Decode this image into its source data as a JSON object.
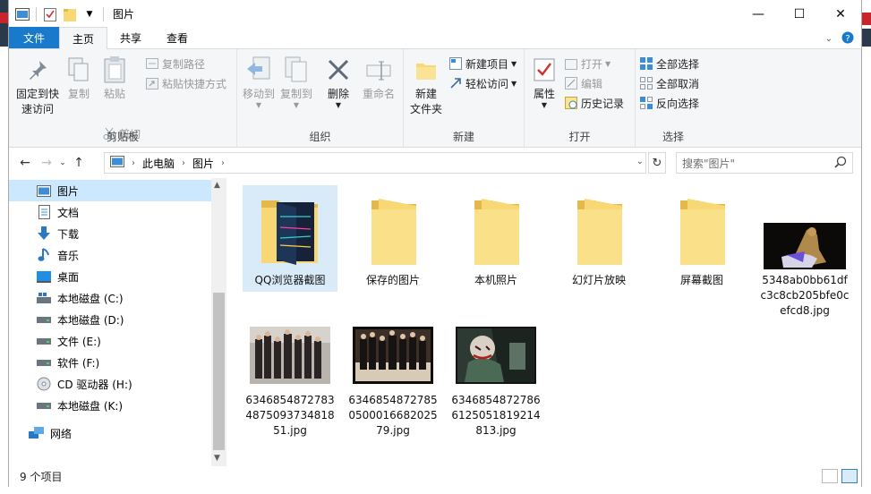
{
  "window": {
    "title": "图片",
    "controls": {
      "minimize": "—",
      "maximize": "☐",
      "close": "✕"
    }
  },
  "tabs": [
    {
      "label": "文件"
    },
    {
      "label": "主页"
    },
    {
      "label": "共享"
    },
    {
      "label": "查看"
    }
  ],
  "ribbon": {
    "clipboard": {
      "group_label": "剪贴板",
      "pin_label_1": "固定到快",
      "pin_label_2": "速访问",
      "copy_label": "复制",
      "paste_label": "粘贴",
      "copy_path_label": "复制路径",
      "paste_shortcut_label": "粘贴快捷方式",
      "cut_label": "剪切"
    },
    "organize": {
      "group_label": "组织",
      "move_to_label": "移动到",
      "copy_to_label": "复制到",
      "delete_label": "删除",
      "rename_label": "重命名"
    },
    "new": {
      "group_label": "新建",
      "new_folder_label_1": "新建",
      "new_folder_label_2": "文件夹",
      "new_item_label": "新建项目",
      "easy_access_label": "轻松访问"
    },
    "open": {
      "group_label": "打开",
      "properties_label": "属性",
      "open_label": "打开",
      "edit_label": "编辑",
      "history_label": "历史记录"
    },
    "select": {
      "group_label": "选择",
      "select_all_label": "全部选择",
      "select_none_label": "全部取消",
      "invert_label": "反向选择"
    }
  },
  "address": {
    "crumbs": [
      "此电脑",
      "图片"
    ],
    "search_placeholder": "搜索\"图片\""
  },
  "nav": {
    "items": [
      {
        "label": "图片",
        "icon": "pictures-icon"
      },
      {
        "label": "文档",
        "icon": "documents-icon"
      },
      {
        "label": "下载",
        "icon": "downloads-icon"
      },
      {
        "label": "音乐",
        "icon": "music-icon"
      },
      {
        "label": "桌面",
        "icon": "desktop-icon"
      },
      {
        "label": "本地磁盘 (C:)",
        "icon": "drive-icon"
      },
      {
        "label": "本地磁盘 (D:)",
        "icon": "drive-icon"
      },
      {
        "label": "文件 (E:)",
        "icon": "drive-icon"
      },
      {
        "label": "软件 (F:)",
        "icon": "drive-icon"
      },
      {
        "label": "CD 驱动器 (H:)",
        "icon": "cd-drive-icon"
      },
      {
        "label": "本地磁盘 (K:)",
        "icon": "drive-icon"
      },
      {
        "label": "网络",
        "icon": "network-icon"
      }
    ]
  },
  "files": [
    {
      "name": "QQ浏览器截图",
      "type": "folder"
    },
    {
      "name": "保存的图片",
      "type": "folder"
    },
    {
      "name": "本机照片",
      "type": "folder"
    },
    {
      "name": "幻灯片放映",
      "type": "folder"
    },
    {
      "name": "屏幕截图",
      "type": "folder"
    },
    {
      "name": "5348ab0bb61dfc3c8cb205bfe0cefcd8.jpg",
      "type": "image"
    },
    {
      "name": "634685487278348750937348185 1.jpg",
      "type": "image"
    },
    {
      "name": "6346854872785050001668202579.jpg",
      "type": "image"
    },
    {
      "name": "6346854872786612505181921 4813.jpg",
      "type": "image"
    }
  ],
  "files_display": [
    "QQ浏览器截图",
    "保存的图片",
    "本机照片",
    "幻灯片放映",
    "屏幕截图",
    "5348ab0bb61dfc3c8cb205bfe0cefcd8.jpg",
    "63468548727834875093734818 51.jpg",
    "63468548727850500016682025 79.jpg",
    "63468548727866125051819214 813.jpg"
  ],
  "status": {
    "count": "9 个项目"
  },
  "colors": {
    "accent": "#1979ca",
    "selected": "#cce8ff",
    "folder": "#f8d775"
  }
}
